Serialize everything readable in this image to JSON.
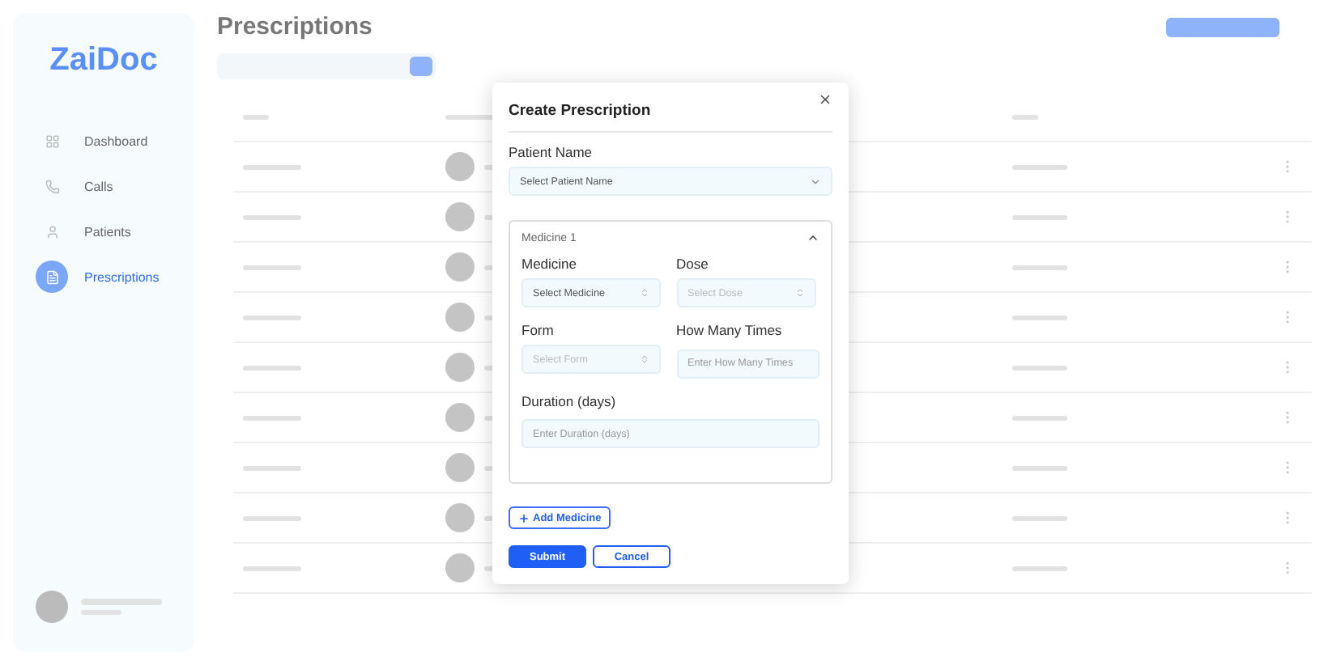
{
  "app": {
    "logo": "ZaiDoc",
    "title": "Prescriptions",
    "nav": [
      {
        "label": "Dashboard",
        "selected": false
      },
      {
        "label": "Calls",
        "selected": false
      },
      {
        "label": "Patients",
        "selected": false
      },
      {
        "label": "Prescriptions",
        "selected": true
      }
    ]
  },
  "dialog": {
    "title": "Create Prescription",
    "patient": {
      "label": "Patient Name",
      "placeholder": "Select Patient Name"
    },
    "medicines": [
      {
        "title": "Medicine 1",
        "expanded": true,
        "fields": [
          {
            "label": "Medicine",
            "placeholder": "Select Medicine",
            "kind": "select",
            "disabled": false
          },
          {
            "label": "Dose",
            "placeholder": "Select Dose",
            "kind": "select",
            "disabled": true
          },
          {
            "label": "Form",
            "placeholder": "Select Form",
            "kind": "select",
            "disabled": true
          },
          {
            "label": "How Many Times",
            "placeholder": "Enter How Many Times",
            "kind": "input",
            "disabled": false
          },
          {
            "label": "Duration (days)",
            "placeholder": "Enter Duration (days)",
            "kind": "input",
            "disabled": false
          }
        ]
      }
    ],
    "add_button": "Add Medicine",
    "submit": "Submit",
    "cancel": "Cancel"
  }
}
